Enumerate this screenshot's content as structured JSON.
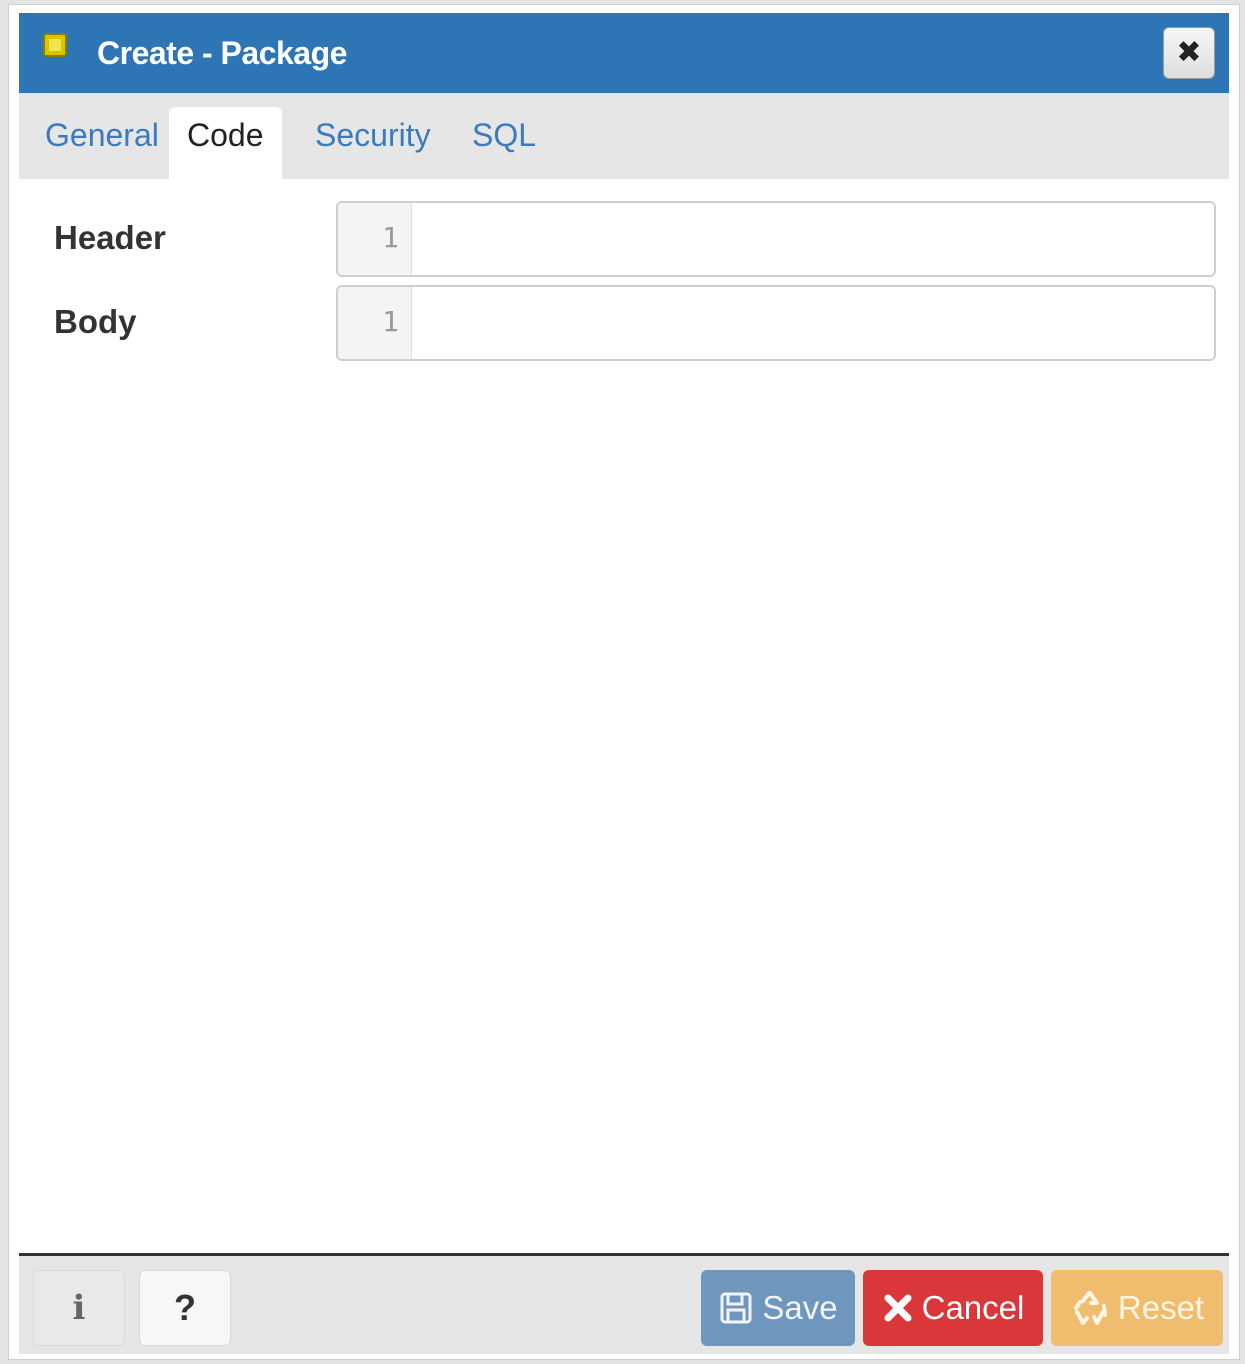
{
  "dialog": {
    "title": "Create - Package",
    "title_icon": "package-icon",
    "close_icon": "close-icon",
    "close_glyph": "✖"
  },
  "tabs": [
    {
      "label": "General",
      "active": false
    },
    {
      "label": "Code",
      "active": true
    },
    {
      "label": "Security",
      "active": false
    },
    {
      "label": "SQL",
      "active": false
    }
  ],
  "fields": {
    "header": {
      "label": "Header",
      "line_number": "1",
      "value": ""
    },
    "body": {
      "label": "Body",
      "line_number": "1",
      "value": ""
    }
  },
  "footer": {
    "info_label": "i",
    "help_label": "?",
    "save_label": "Save",
    "save_icon": "floppy-disk-icon",
    "cancel_label": "Cancel",
    "cancel_icon": "x-icon",
    "reset_label": "Reset",
    "reset_icon": "recycle-icon"
  },
  "colors": {
    "titlebar": "#2d75b4",
    "tab_link": "#3a7bbf",
    "save": "#6f97bd",
    "cancel": "#d9373a",
    "reset": "#f0bc6e"
  }
}
